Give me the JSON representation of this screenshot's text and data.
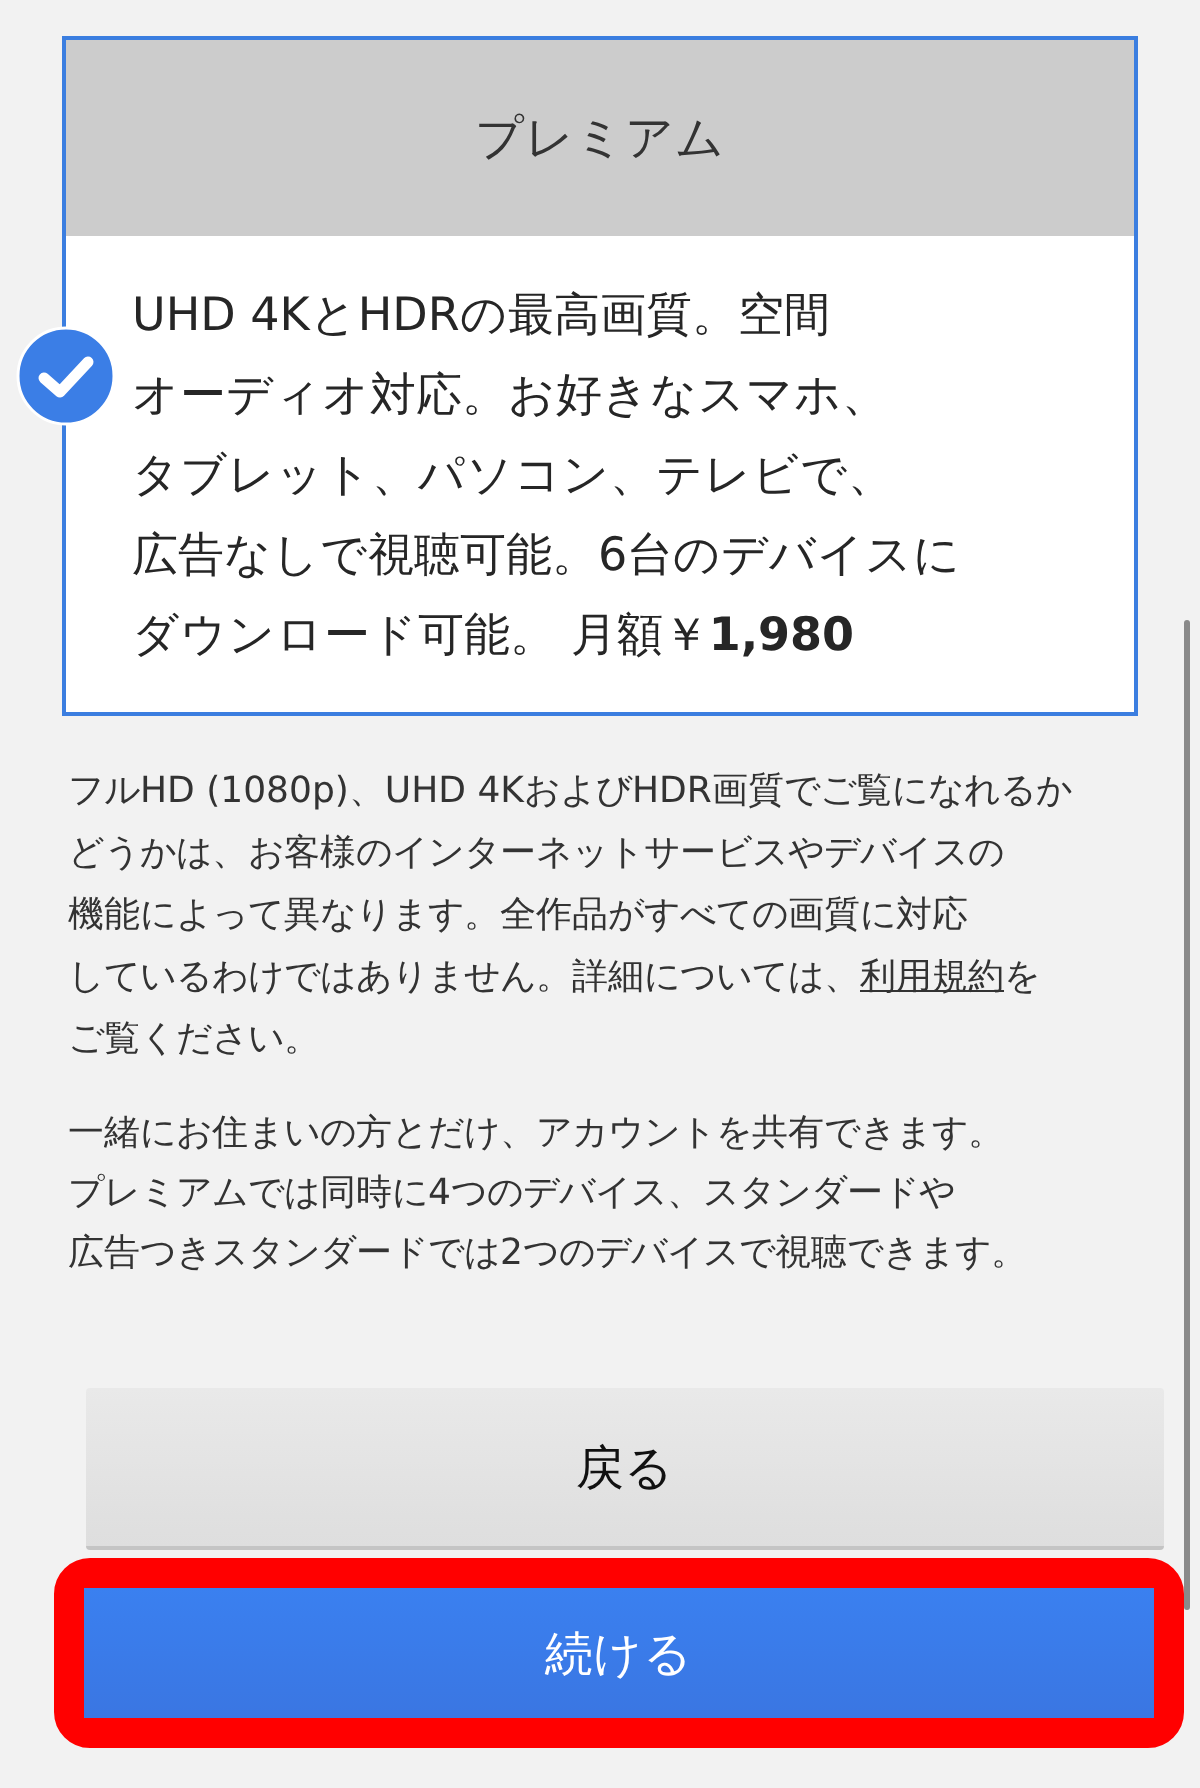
{
  "plan_card": {
    "title": "プレミアム",
    "selected": true,
    "description": [
      "UHD 4KとHDRの最高画質。空間",
      "オーディオ対応。お好きなスマホ、",
      "タブレット、パソコン、テレビで、",
      "広告なしで視聴可能。6台のデバイスに",
      "ダウンロード可能。 月額￥**1,980**"
    ]
  },
  "notes": [
    {
      "kind": "quality",
      "lines": [
        [
          {
            "kind": "text",
            "text": "フルHD (1080p)、UHD 4KおよびHDR画質でご覧になれるか"
          }
        ],
        [
          {
            "kind": "text",
            "text": "どうかは、お客様のインターネットサービスやデバイスの"
          }
        ],
        [
          {
            "kind": "text",
            "text": "機能によって異なります。全作品がすべての画質に対応"
          }
        ],
        [
          {
            "kind": "text",
            "text": "しているわけではありません。詳細については、"
          },
          {
            "kind": "link",
            "text": "利用規約"
          },
          {
            "kind": "text",
            "text": "を"
          }
        ],
        [
          {
            "kind": "text",
            "text": "ご覧ください。"
          }
        ]
      ]
    },
    {
      "kind": "sharing",
      "lines": [
        [
          {
            "kind": "text",
            "text": "一緒にお住まいの方とだけ、アカウントを共有できます。"
          }
        ],
        [
          {
            "kind": "text",
            "text": "プレミアムでは同時に4つのデバイス、スタンダードや"
          }
        ],
        [
          {
            "kind": "text",
            "text": "広告つきスタンダードでは2つのデバイスで視聴できます。"
          }
        ]
      ]
    }
  ],
  "buttons": [
    {
      "label": "戻る",
      "kind": "secondary",
      "highlighted": false
    },
    {
      "label": "続ける",
      "kind": "primary",
      "highlighted": true
    }
  ]
}
